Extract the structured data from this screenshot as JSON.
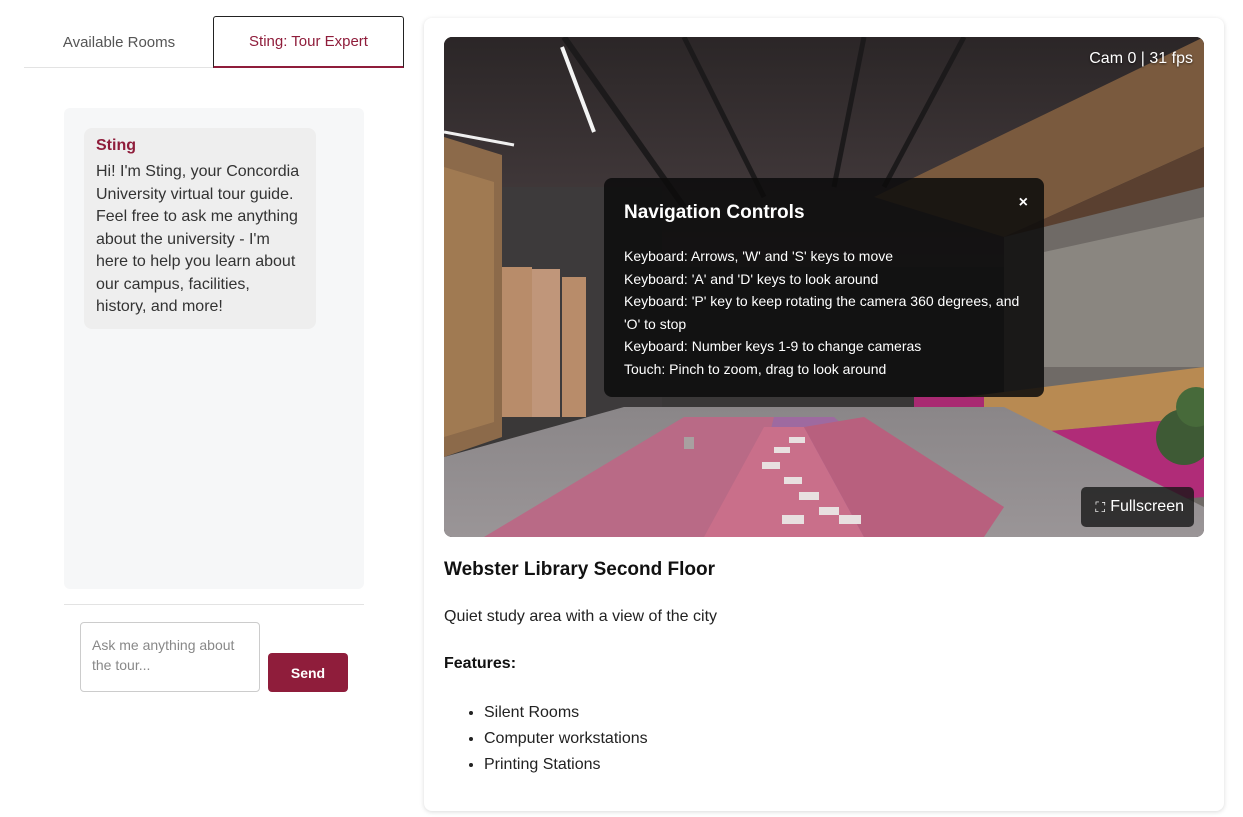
{
  "tabs": [
    {
      "label": "Available Rooms",
      "active": false
    },
    {
      "label": "Sting: Tour Expert",
      "active": true
    }
  ],
  "chat": {
    "messages": [
      {
        "sender": "Sting",
        "text": "Hi! I'm Sting, your Concordia University virtual tour guide. Feel free to ask me anything about the university - I'm here to help you learn about our campus, facilities, history, and more!"
      }
    ],
    "input_placeholder": "Ask me anything about the tour...",
    "send_label": "Send"
  },
  "viewer": {
    "cam_readout": "Cam 0 | 31 fps",
    "fullscreen_label": "Fullscreen",
    "fullscreen_icon": "fullscreen-icon",
    "close_icon": "close-icon",
    "nav_panel": {
      "title": "Navigation Controls",
      "close_symbol": "×",
      "lines": [
        "Keyboard: Arrows, 'W' and 'S' keys to move",
        "Keyboard: 'A' and 'D' keys to look around",
        "Keyboard: 'P' key to keep rotating the camera 360 degrees, and 'O' to stop",
        "Keyboard: Number keys 1-9 to change cameras",
        "Touch: Pinch to zoom, drag to look around"
      ]
    }
  },
  "room": {
    "title": "Webster Library Second Floor",
    "description": "Quiet study area with a view of the city",
    "features_label": "Features:",
    "features": [
      "Silent Rooms",
      "Computer workstations",
      "Printing Stations"
    ]
  },
  "colors": {
    "accent": "#8f1d3b"
  }
}
